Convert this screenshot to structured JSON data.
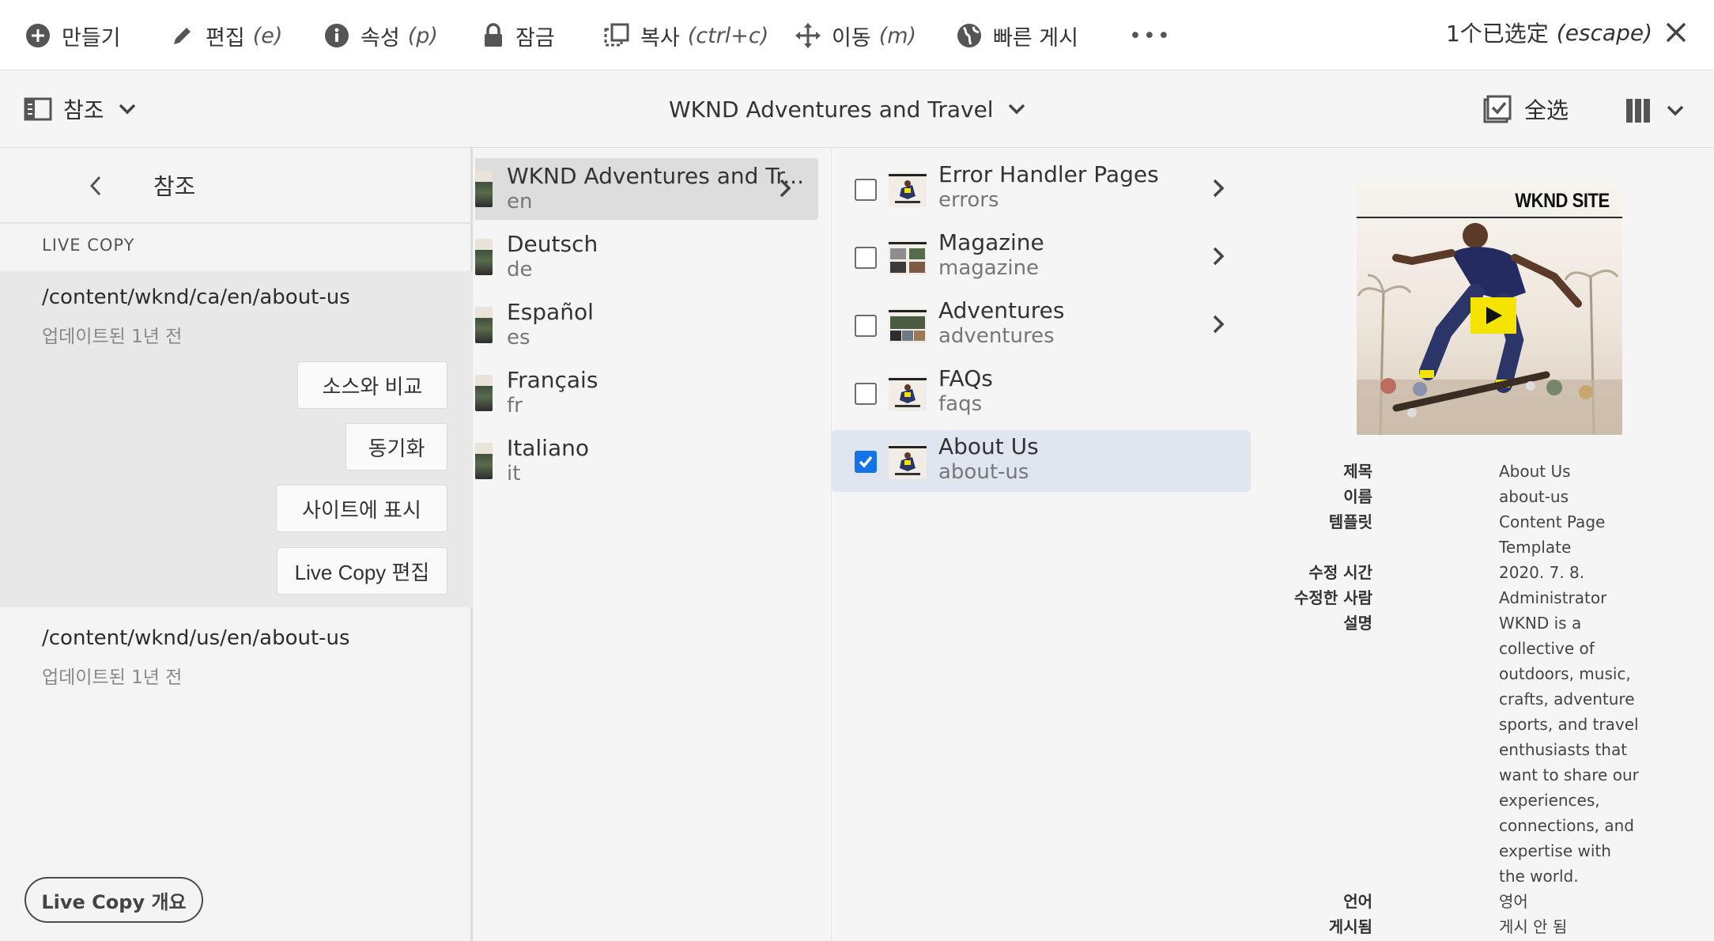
{
  "actionbar": {
    "create": "만들기",
    "edit": "편집",
    "edit_kbd": "(e)",
    "properties": "속성",
    "properties_kbd": "(p)",
    "lock": "잠금",
    "copy": "복사",
    "copy_kbd": "(ctrl+c)",
    "move": "이동",
    "move_kbd": "(m)",
    "quick_publish": "빠른 게시",
    "more": "•••",
    "selection_count": "1个已选定",
    "selection_kbd": "(escape)"
  },
  "secondarybar": {
    "rail_label": "참조",
    "breadcrumb": "WKND Adventures and Travel",
    "select_all": "全选"
  },
  "rail": {
    "title": "참조",
    "section_label": "LIVE COPY",
    "items": [
      {
        "path": "/content/wknd/ca/en/about-us",
        "meta": "업데이트된 1년 전",
        "buttons": [
          "소스와 비교",
          "동기화",
          "사이트에 표시",
          "Live Copy 편집"
        ]
      },
      {
        "path": "/content/wknd/us/en/about-us",
        "meta": "업데이트된 1년 전"
      }
    ],
    "overview_button": "Live Copy 개요"
  },
  "column1": [
    {
      "title": "WKND Adventures and Tr...",
      "name": "en"
    },
    {
      "title": "Deutsch",
      "name": "de"
    },
    {
      "title": "Español",
      "name": "es"
    },
    {
      "title": "Français",
      "name": "fr"
    },
    {
      "title": "Italiano",
      "name": "it"
    }
  ],
  "column2": [
    {
      "title": "Error Handler Pages",
      "name": "errors",
      "checked": false
    },
    {
      "title": "Magazine",
      "name": "magazine",
      "checked": false
    },
    {
      "title": "Adventures",
      "name": "adventures",
      "checked": false
    },
    {
      "title": "FAQs",
      "name": "faqs",
      "checked": false
    },
    {
      "title": "About Us",
      "name": "about-us",
      "checked": true
    }
  ],
  "preview": {
    "logo": "WKND SITE",
    "fields": [
      {
        "label": "제목",
        "value": "About Us"
      },
      {
        "label": "이름",
        "value": "about-us"
      },
      {
        "label": "템플릿",
        "value": "Content Page Template"
      },
      {
        "label": "수정 시간",
        "value": "2020. 7. 8."
      },
      {
        "label": "수정한 사람",
        "value": "Administrator"
      },
      {
        "label": "설명",
        "value": "WKND is a collective of outdoors, music, crafts, adventure sports, and travel enthusiasts that want to share our experiences, connections, and expertise with the world."
      },
      {
        "label": "언어",
        "value": "영어"
      },
      {
        "label": "게시됨",
        "value": "게시 안 됨"
      }
    ]
  },
  "colors": {
    "accent": "#1473e6",
    "selected_row": "#dfe6f0",
    "play_button": "#f5e400"
  }
}
